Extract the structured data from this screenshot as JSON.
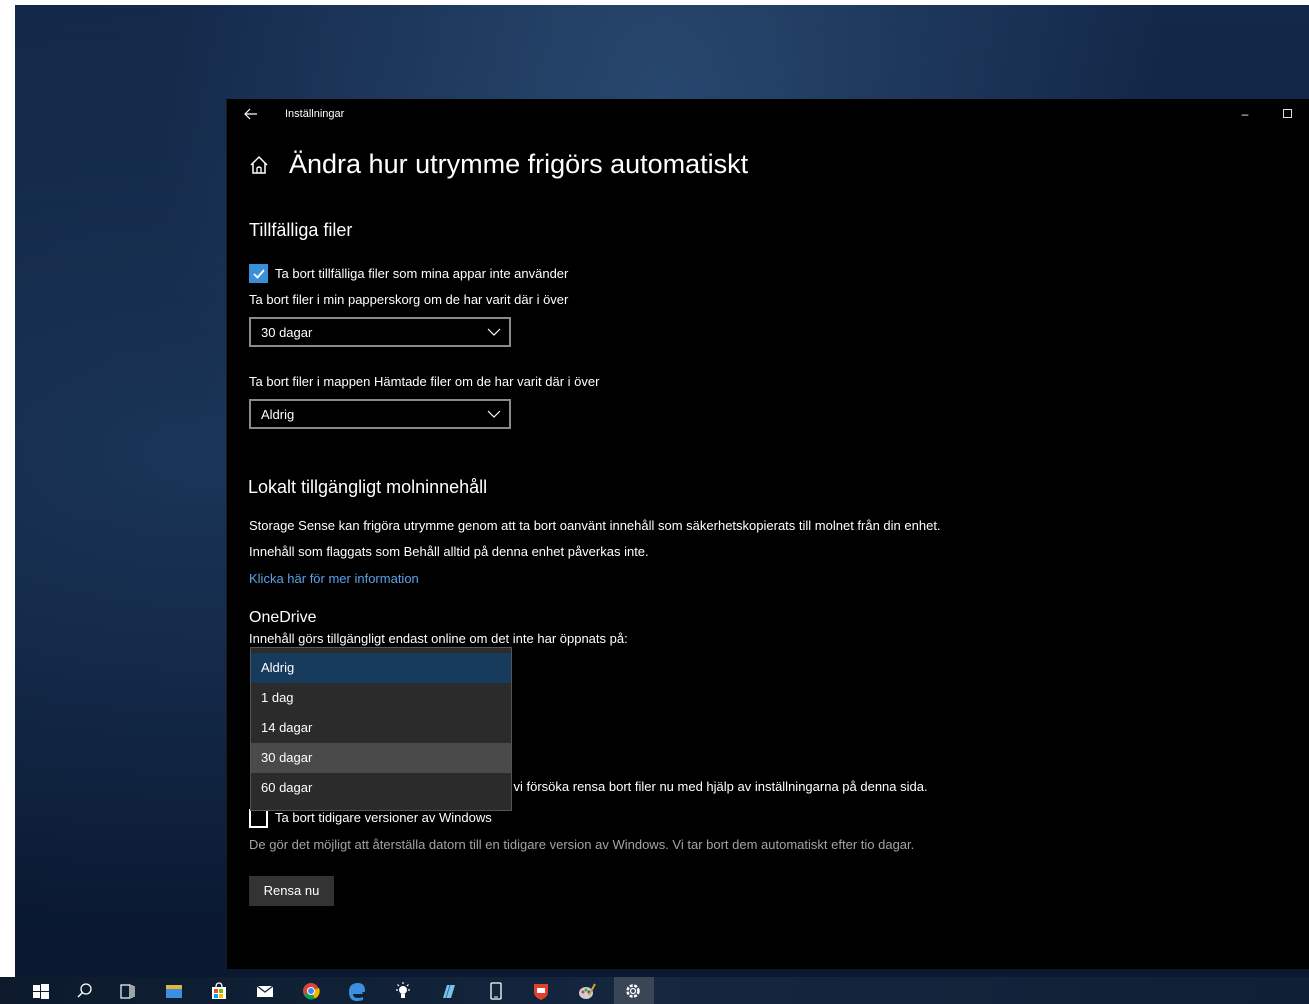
{
  "window": {
    "app_title": "Inställningar",
    "minimize_glyph": "–"
  },
  "page": {
    "title": "Ändra hur utrymme frigörs automatiskt"
  },
  "temp_files": {
    "heading": "Tillfälliga filer",
    "checkbox_label": "Ta bort tillfälliga filer som mina appar inte använder",
    "checkbox_checked": true,
    "recycle_label": "Ta bort filer i min papperskorg om de har varit där i över",
    "recycle_value": "30 dagar",
    "downloads_label": "Ta bort filer i mappen Hämtade filer om de har varit där i över",
    "downloads_value": "Aldrig"
  },
  "cloud": {
    "heading": "Lokalt tillgängligt molninnehåll",
    "desc_line1": "Storage Sense kan frigöra utrymme genom att ta bort oanvänt innehåll som säkerhetskopierats till molnet från din enhet.",
    "desc_line2": "Innehåll som flaggats som Behåll alltid på denna enhet påverkas inte.",
    "link": "Klicka här för mer information",
    "onedrive_heading": "OneDrive",
    "onedrive_label": "Innehåll görs tillgängligt endast online om det inte har öppnats på:"
  },
  "dropdown": {
    "options": [
      "Aldrig",
      "1 dag",
      "14 dagar",
      "30 dagar",
      "60 dagar"
    ],
    "selected": "Aldrig",
    "hovered": "30 dagar"
  },
  "free_now": {
    "partial_text": "i vi försöka rensa bort filer nu med hjälp av inställningarna på denna sida.",
    "prev_windows_label": "Ta bort tidigare versioner av Windows",
    "prev_windows_checked": false,
    "prev_windows_desc": "De gör det möjligt att återställa datorn till en tidigare version av Windows. Vi tar bort dem automatiskt efter tio dagar.",
    "clean_button": "Rensa nu"
  },
  "taskbar": {
    "icons": [
      "windows-start-icon",
      "search-icon",
      "task-view-icon",
      "file-explorer-icon",
      "store-icon",
      "mail-icon",
      "chrome-icon",
      "edge-icon",
      "bulb-icon",
      "notes-icon",
      "phone-icon",
      "badge-icon",
      "paint-icon",
      "settings-icon"
    ],
    "active": "settings-icon"
  },
  "colors": {
    "accent": "#3a8fd9",
    "link": "#5aa0e6",
    "window_bg": "#000000",
    "dropdown_bg": "#2b2b2b",
    "dropdown_selected": "#173b5c"
  }
}
